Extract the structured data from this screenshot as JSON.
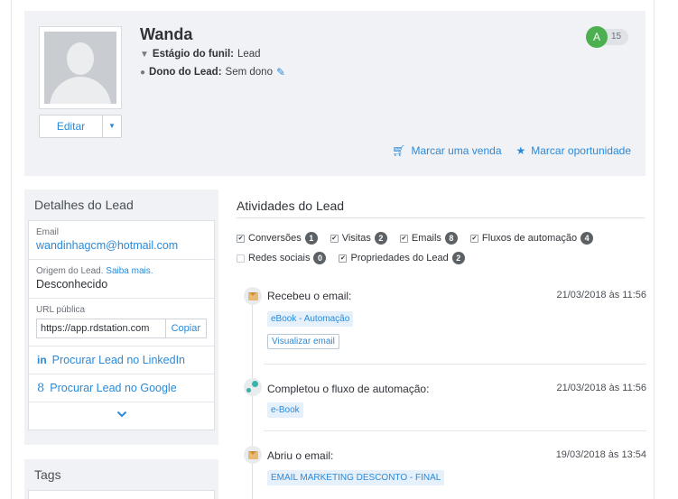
{
  "lead": {
    "name": "Wanda",
    "stage_label": "Estágio do funil:",
    "stage_value": "Lead",
    "owner_label": "Dono do Lead:",
    "owner_value": "Sem dono",
    "grade": "A",
    "score": "15"
  },
  "header": {
    "edit_label": "Editar",
    "mark_sale_label": "Marcar uma venda",
    "mark_opportunity_label": "Marcar oportunidade"
  },
  "details": {
    "title": "Detalhes do Lead",
    "email_label": "Email",
    "email_value": "wandinhagcm@hotmail.com",
    "origin_label": "Origem do Lead.",
    "origin_learn_more": "Saiba mais.",
    "origin_value": "Desconhecido",
    "public_url_label": "URL pública",
    "public_url_value": "https://app.rdstation.com",
    "copy_label": "Copiar",
    "linkedin_icon": "in",
    "linkedin_label": "Procurar Lead no LinkedIn",
    "google_icon": "8",
    "google_label": "Procurar Lead no Google"
  },
  "tags": {
    "title": "Tags"
  },
  "activities": {
    "title": "Atividades do Lead",
    "filters": [
      {
        "label": "Conversões",
        "count": "1",
        "checked": true
      },
      {
        "label": "Visitas",
        "count": "2",
        "checked": true
      },
      {
        "label": "Emails",
        "count": "8",
        "checked": true
      },
      {
        "label": "Fluxos de automação",
        "count": "4",
        "checked": true
      },
      {
        "label": "Redes sociais",
        "count": "0",
        "checked": false
      },
      {
        "label": "Propriedades do Lead",
        "count": "2",
        "checked": true
      }
    ],
    "items": [
      {
        "title": "Recebeu o email:",
        "date": "21/03/2018 às 11:56",
        "chip": "eBook - Automação",
        "button": "Visualizar email"
      },
      {
        "title": "Completou o fluxo de automação:",
        "date": "21/03/2018 às 11:56",
        "chip": "e-Book"
      },
      {
        "title": "Abriu o email:",
        "date": "19/03/2018 às 13:54",
        "chip": "EMAIL MARKETING DESCONTO - FINAL"
      }
    ]
  },
  "colors": {
    "accent": "#2b8ad8",
    "panel_bg": "#f0f2f6",
    "grade_green": "#4caf50"
  },
  "icons": {
    "stage": "funnel-icon",
    "owner": "user-icon",
    "edit_owner": "pencil-icon",
    "sale": "cart-icon",
    "opportunity": "star-icon",
    "received_email": "envelope-icon",
    "flow": "automation-flow-icon",
    "expand": "chevron-down-icon"
  }
}
